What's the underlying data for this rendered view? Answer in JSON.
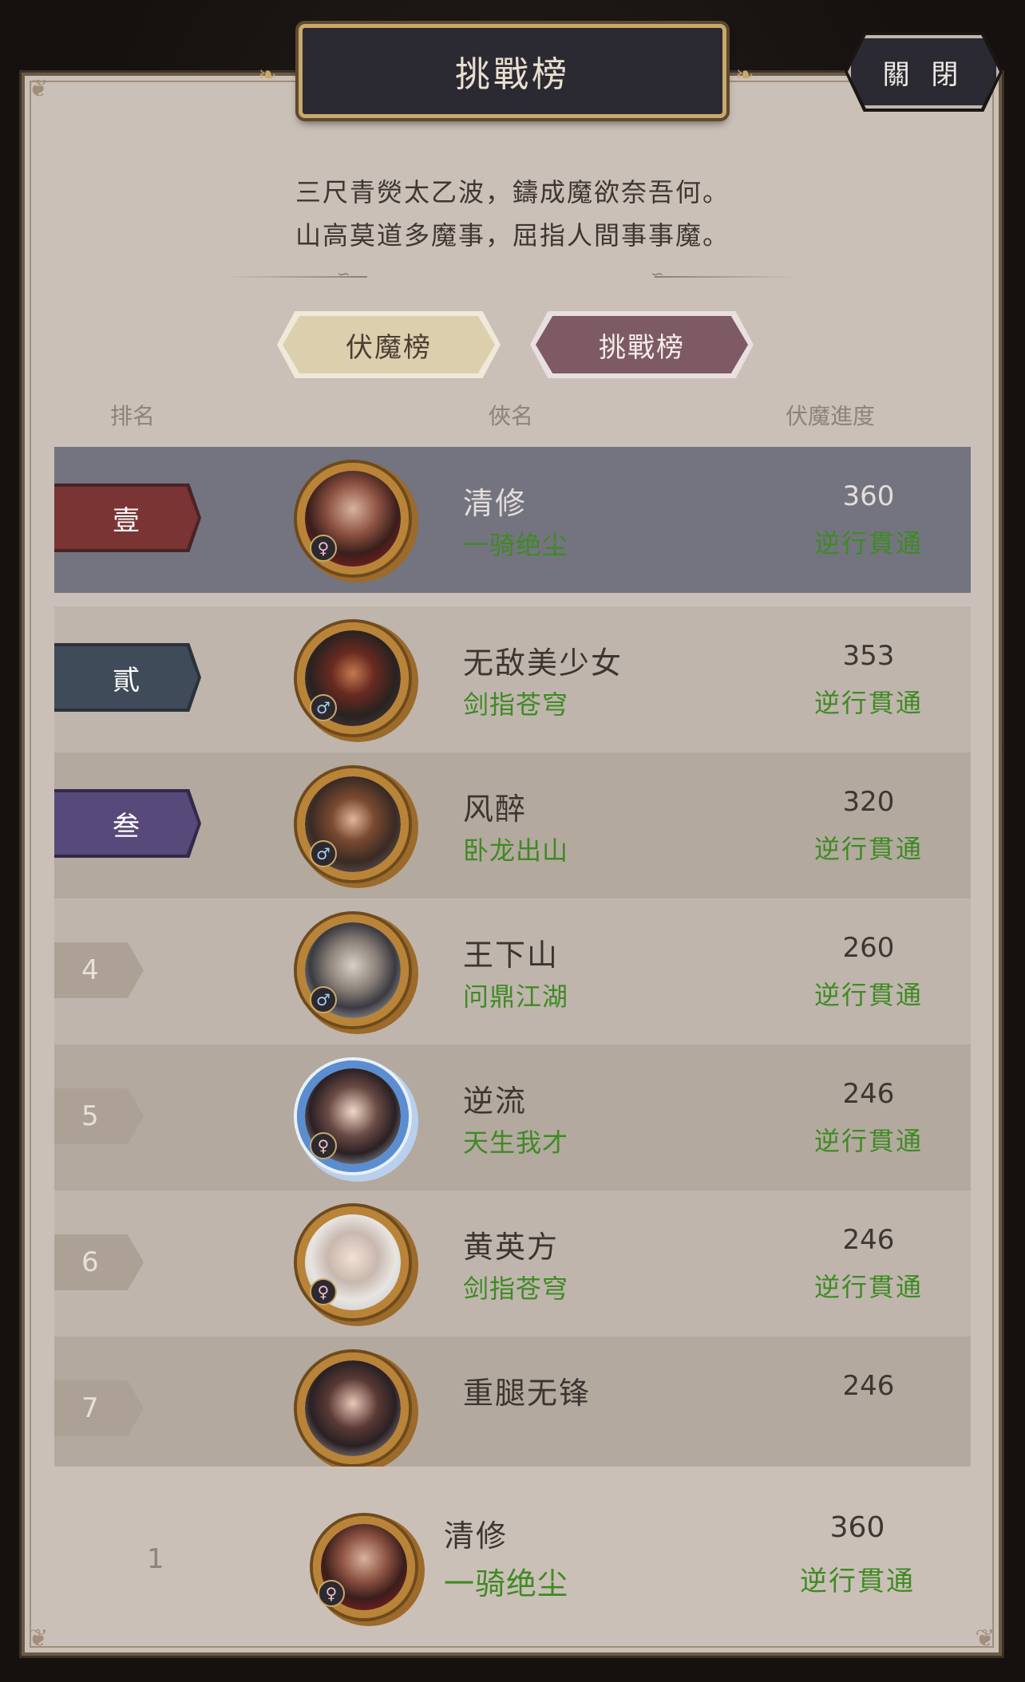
{
  "header": {
    "title": "挑戰榜",
    "close_label": "關 閉"
  },
  "poem": {
    "line1": "三尺青熒太乙波，鑄成魔欲奈吾何。",
    "line2": "山高莫道多魔事，屈指人間事事魔。"
  },
  "tabs": [
    {
      "label": "伏魔榜",
      "active": false
    },
    {
      "label": "挑戰榜",
      "active": true
    }
  ],
  "columns": {
    "rank": "排名",
    "name": "俠名",
    "progress": "伏魔進度"
  },
  "rows": [
    {
      "rank": "壹",
      "name": "清修",
      "title": "一骑绝尘",
      "score": "360",
      "progress": "逆行貫通",
      "gender": "♀"
    },
    {
      "rank": "貳",
      "name": "无敌美少女",
      "title": "剑指苍穹",
      "score": "353",
      "progress": "逆行貫通",
      "gender": "♂"
    },
    {
      "rank": "叁",
      "name": "风醉",
      "title": "卧龙出山",
      "score": "320",
      "progress": "逆行貫通",
      "gender": "♂"
    },
    {
      "rank": "4",
      "name": "王下山",
      "title": "问鼎江湖",
      "score": "260",
      "progress": "逆行貫通",
      "gender": "♂"
    },
    {
      "rank": "5",
      "name": "逆流",
      "title": "天生我才",
      "score": "246",
      "progress": "逆行貫通",
      "gender": "♀"
    },
    {
      "rank": "6",
      "name": "黄英方",
      "title": "剑指苍穹",
      "score": "246",
      "progress": "逆行貫通",
      "gender": "♀"
    },
    {
      "rank": "7",
      "name": "重腿无锋",
      "title": "",
      "score": "246",
      "progress": "",
      "gender": "♀"
    }
  ],
  "self": {
    "rank": "1",
    "name": "清修",
    "title": "一骑绝尘",
    "score": "360",
    "progress": "逆行貫通",
    "gender": "♀"
  },
  "colors": {
    "green": "#3f8a23",
    "rank1": "#7a3434",
    "rank2": "#3f4b58",
    "rank3": "#574a7a",
    "highlight": "#737480"
  }
}
